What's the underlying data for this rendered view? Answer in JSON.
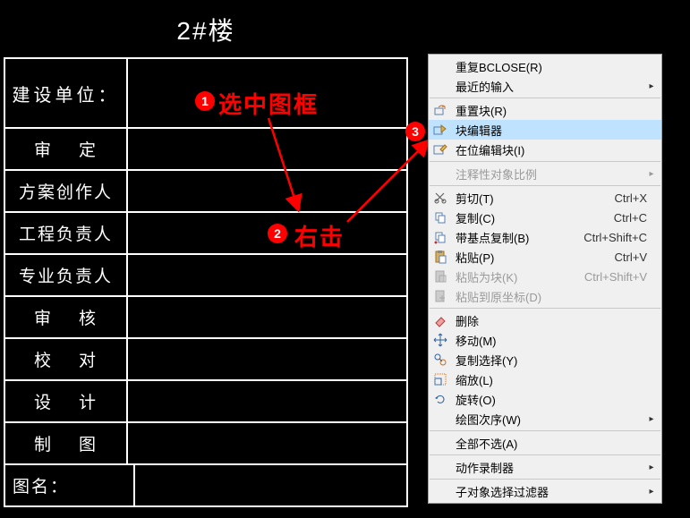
{
  "title_block": {
    "header": "2#楼",
    "rows": [
      {
        "label": "建设单位：",
        "big": true
      },
      {
        "label": "审    定"
      },
      {
        "label": "方案创作人"
      },
      {
        "label": "工程负责人"
      },
      {
        "label": "专业负责人"
      },
      {
        "label": "审    核"
      },
      {
        "label": "校    对"
      },
      {
        "label": "设    计"
      },
      {
        "label": "制    图"
      },
      {
        "label": "图名："
      }
    ]
  },
  "annotations": {
    "n1": {
      "num": "1",
      "text": "选中图框"
    },
    "n2": {
      "num": "2",
      "text": "右击"
    },
    "n3": {
      "num": "3"
    }
  },
  "context_menu": {
    "items": [
      {
        "label": "重复BCLOSE(R)"
      },
      {
        "label": "最近的输入",
        "submenu": true
      },
      {
        "sep": true
      },
      {
        "label": "重置块(R)",
        "icon": "reset-block-icon"
      },
      {
        "label": "块编辑器",
        "icon": "block-editor-icon",
        "hl": true
      },
      {
        "label": "在位编辑块(I)",
        "icon": "edit-in-place-icon"
      },
      {
        "sep": true
      },
      {
        "label": "注释性对象比例",
        "submenu": true,
        "disabled": true
      },
      {
        "sep": true
      },
      {
        "label": "剪切(T)",
        "icon": "cut-icon",
        "shortcut": "Ctrl+X"
      },
      {
        "label": "复制(C)",
        "icon": "copy-icon",
        "shortcut": "Ctrl+C"
      },
      {
        "label": "带基点复制(B)",
        "icon": "copy-base-icon",
        "shortcut": "Ctrl+Shift+C"
      },
      {
        "label": "粘贴(P)",
        "icon": "paste-icon",
        "shortcut": "Ctrl+V"
      },
      {
        "label": "粘贴为块(K)",
        "icon": "paste-block-icon",
        "shortcut": "Ctrl+Shift+V",
        "disabled": true
      },
      {
        "label": "粘贴到原坐标(D)",
        "icon": "paste-orig-icon",
        "disabled": true
      },
      {
        "sep": true
      },
      {
        "label": "删除",
        "icon": "erase-icon"
      },
      {
        "label": "移动(M)",
        "icon": "move-icon"
      },
      {
        "label": "复制选择(Y)",
        "icon": "copy-sel-icon"
      },
      {
        "label": "缩放(L)",
        "icon": "scale-icon"
      },
      {
        "label": "旋转(O)",
        "icon": "rotate-icon"
      },
      {
        "label": "绘图次序(W)",
        "submenu": true
      },
      {
        "sep": true
      },
      {
        "label": "全部不选(A)"
      },
      {
        "sep": true
      },
      {
        "label": "动作录制器",
        "submenu": true
      },
      {
        "sep": true
      },
      {
        "label": "子对象选择过滤器",
        "submenu": true
      }
    ]
  }
}
